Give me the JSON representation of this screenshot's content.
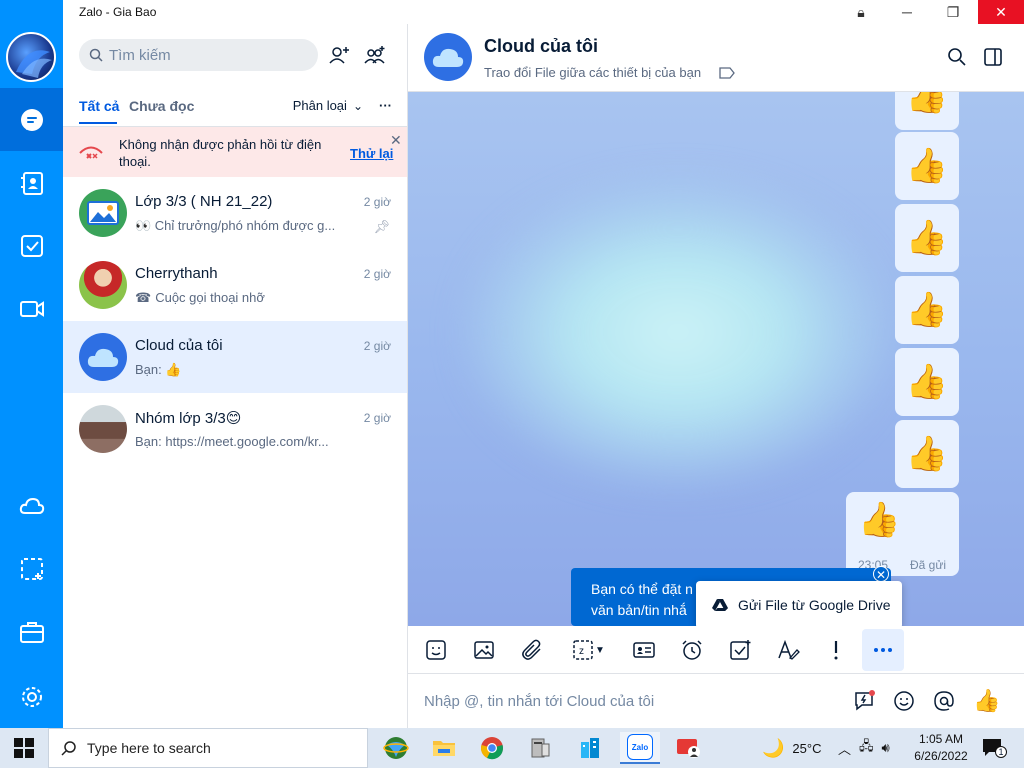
{
  "window": {
    "title": "Zalo - Gia Bao"
  },
  "sidebar": {
    "items": [
      {
        "name": "messages",
        "icon": "chat-bubble-icon"
      },
      {
        "name": "contacts",
        "icon": "contact-book-icon"
      },
      {
        "name": "todo",
        "icon": "checkbox-icon"
      },
      {
        "name": "video",
        "icon": "video-camera-icon"
      },
      {
        "name": "cloud",
        "icon": "cloud-icon"
      },
      {
        "name": "screenshot",
        "icon": "screen-capture-icon"
      },
      {
        "name": "toolbox",
        "icon": "briefcase-icon"
      },
      {
        "name": "settings",
        "icon": "gear-icon"
      }
    ]
  },
  "search": {
    "placeholder": "Tìm kiếm"
  },
  "tabs": {
    "all": "Tất cả",
    "unread": "Chưa đọc",
    "filter": "Phân loại"
  },
  "warning": {
    "text": "Không nhận được phản hồi từ điện thoại.",
    "retry": "Thử lại"
  },
  "conversations": [
    {
      "name": "Lớp 3/3 ( NH 21_22)",
      "preview": "👀 Chỉ trưởng/phó nhóm được g...",
      "time": "2 giờ",
      "pinned": true
    },
    {
      "name": "Cherrythanh",
      "preview": "Cuộc gọi thoại nhỡ",
      "time": "2 giờ"
    },
    {
      "name": "Cloud của tôi",
      "preview": "Bạn: 👍",
      "time": "2 giờ",
      "active": true
    },
    {
      "name": "Nhóm lớp 3/3😊",
      "preview": "Bạn: https://meet.google.com/kr...",
      "time": "2 giờ"
    }
  ],
  "chat": {
    "title": "Cloud của tôi",
    "subtitle": "Trao đổi File giữa các thiết bị của bạn",
    "last_message": {
      "emoji": "👍",
      "time": "23:05",
      "status": "Đã gửi"
    },
    "like_emoji": "👍",
    "tooltip": "Bạn có thể đặt nhắc hẹn cho văn bản/tin nhắn",
    "tooltip_line1": "Bạn có thể đặt n",
    "tooltip_line2": "văn bản/tin nhắ",
    "gdrive": "Gửi File từ Google Drive",
    "composer_placeholder": "Nhập @, tin nhắn tới Cloud của tôi"
  },
  "taskbar": {
    "search_placeholder": "Type here to search",
    "weather": "25°C",
    "time": "1:05 AM",
    "date": "6/26/2022",
    "notif_count": "1"
  },
  "colors": {
    "brand": "#0091ff",
    "active_rail": "#006edc",
    "accent": "#005ae0"
  }
}
